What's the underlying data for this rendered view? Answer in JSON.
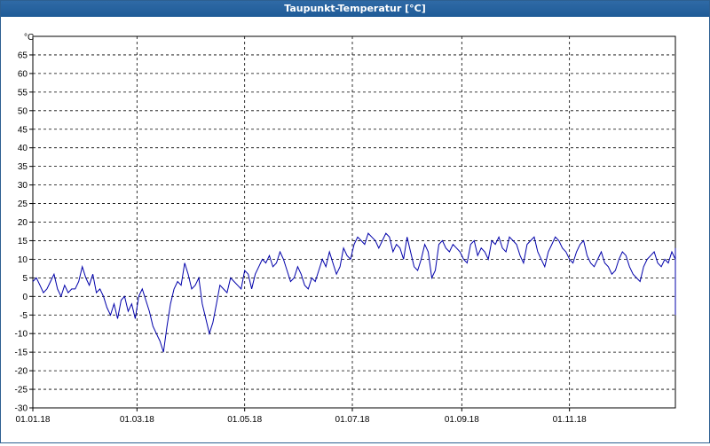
{
  "window": {
    "title": "Taupunkt-Temperatur [°C]"
  },
  "chart_data": {
    "type": "line",
    "title": "Taupunkt-Temperatur [°C]",
    "ylabel": "°C",
    "ylim": [
      -30,
      70
    ],
    "yticks": [
      -30,
      -25,
      -20,
      -15,
      -10,
      -5,
      0,
      5,
      10,
      15,
      20,
      25,
      30,
      35,
      40,
      45,
      50,
      55,
      60,
      65
    ],
    "xlim": [
      "01.01.18",
      "31.12.18"
    ],
    "xticks": [
      "01.01.18",
      "01.03.18",
      "01.05.18",
      "01.07.18",
      "01.09.18",
      "01.11.18"
    ],
    "grid": true,
    "line_color": "#0000aa",
    "series": [
      {
        "name": "",
        "x_start": "01.01.18",
        "x_step_days": 2,
        "values": [
          4,
          5,
          3,
          1,
          2,
          4,
          6,
          2,
          0,
          3,
          1,
          2,
          2,
          4,
          8,
          5,
          3,
          6,
          1,
          2,
          0,
          -3,
          -5,
          -2,
          -6,
          -1,
          0,
          -4,
          -2,
          -6,
          0,
          2,
          -1,
          -4,
          -8,
          -10,
          -12,
          -15,
          -8,
          -2,
          2,
          4,
          3,
          9,
          6,
          2,
          3,
          5,
          -2,
          -6,
          -10,
          -7,
          -2,
          3,
          2,
          1,
          5,
          4,
          3,
          2,
          7,
          6,
          2,
          6,
          8,
          10,
          9,
          11,
          8,
          9,
          12,
          10,
          7,
          4,
          5,
          8,
          6,
          3,
          2,
          5,
          4,
          7,
          10,
          8,
          12,
          9,
          6,
          8,
          13,
          11,
          10,
          14,
          16,
          15,
          14,
          17,
          16,
          15,
          13,
          15,
          17,
          16,
          12,
          14,
          13,
          10,
          16,
          12,
          8,
          7,
          10,
          14,
          12,
          5,
          7,
          14,
          15,
          13,
          12,
          14,
          13,
          12,
          10,
          9,
          14,
          15,
          11,
          13,
          12,
          10,
          15,
          14,
          16,
          13,
          12,
          16,
          15,
          14,
          11,
          9,
          14,
          15,
          16,
          12,
          10,
          8,
          12,
          14,
          16,
          15,
          13,
          12,
          10,
          9,
          12,
          14,
          15,
          11,
          9,
          8,
          10,
          12,
          9,
          8,
          6,
          7,
          10,
          12,
          11,
          8,
          6,
          5,
          4,
          8,
          10,
          11,
          12,
          9,
          8,
          10,
          9,
          12,
          10,
          8,
          7,
          6,
          8,
          5,
          4,
          2,
          3,
          6,
          8,
          10,
          7,
          4,
          2,
          3,
          5,
          4,
          3,
          4,
          2,
          0,
          2,
          5,
          6,
          4,
          3,
          5,
          8,
          10,
          7,
          6,
          4,
          2,
          0,
          -2,
          -4,
          -5,
          0,
          2,
          8,
          9,
          3,
          7,
          10,
          5,
          9,
          7,
          10,
          11,
          9,
          8,
          7,
          5,
          10,
          12,
          9,
          6,
          5,
          9,
          7,
          4,
          3,
          5,
          6,
          8,
          9,
          7,
          5,
          3,
          1,
          0,
          4,
          6,
          8,
          9,
          8,
          7,
          6,
          8,
          9,
          10,
          8,
          7,
          6,
          5,
          4,
          3,
          1,
          0,
          2,
          1,
          -2,
          -4,
          -3,
          -5,
          0,
          3,
          5,
          7,
          9,
          8,
          6,
          5,
          7,
          10,
          11,
          9,
          8,
          6,
          4,
          2,
          0,
          -1,
          -2,
          1,
          3,
          5,
          7,
          9,
          11,
          12,
          10,
          11,
          12,
          11,
          10,
          8,
          7,
          4,
          2,
          1,
          3,
          5,
          6,
          8,
          10,
          12,
          13,
          12,
          10,
          8,
          6,
          5,
          4,
          3,
          5,
          7,
          8,
          10,
          11,
          9,
          7,
          5,
          6,
          7,
          6,
          4,
          3,
          4,
          6,
          7,
          8,
          8,
          6,
          4,
          2,
          0,
          -1,
          0,
          2,
          3,
          5,
          6
        ]
      }
    ]
  }
}
